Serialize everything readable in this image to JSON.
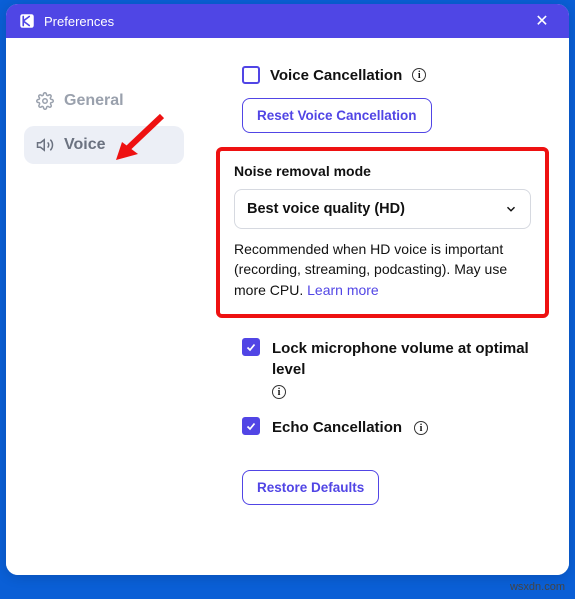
{
  "titlebar": {
    "title": "Preferences"
  },
  "sidebar": {
    "items": [
      {
        "label": "General"
      },
      {
        "label": "Voice"
      }
    ]
  },
  "content": {
    "voice_cancel_label": "Voice Cancellation",
    "reset_btn": "Reset Voice Cancellation",
    "noise_section": {
      "title": "Noise removal mode",
      "selected": "Best voice quality (HD)",
      "desc": "Recommended when HD voice is important (recording, streaming, podcasting). May use more CPU.",
      "learn": "Learn more"
    },
    "lock_mic_label": "Lock microphone volume at optimal level",
    "echo_label": "Echo Cancellation",
    "restore_btn": "Restore Defaults"
  },
  "watermark": "wsxdn.com"
}
